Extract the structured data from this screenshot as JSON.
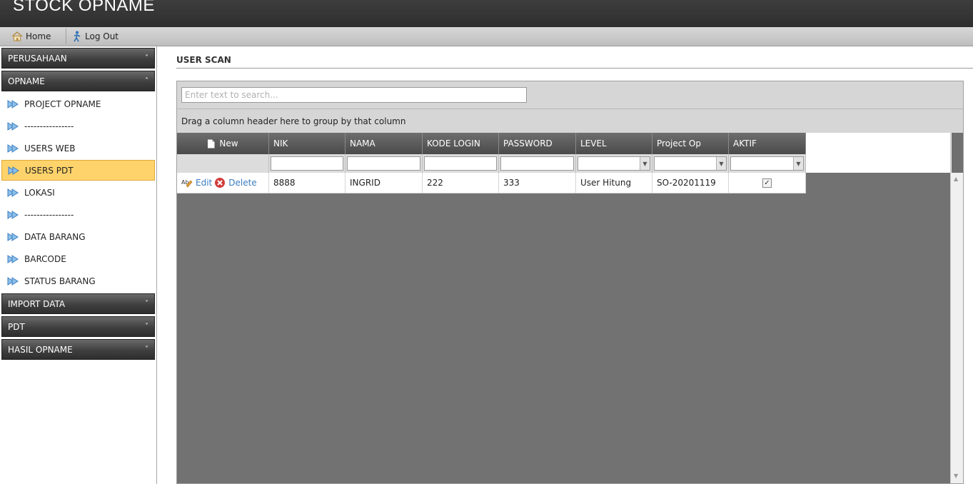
{
  "app": {
    "title": "STOCK OPNAME"
  },
  "nav": {
    "home_label": "Home",
    "logout_label": "Log Out"
  },
  "sidebar": {
    "groups": [
      {
        "label": "PERUSAHAAN",
        "chevron": "˅"
      },
      {
        "label": "OPNAME",
        "chevron": "˄"
      },
      {
        "label": "IMPORT DATA",
        "chevron": "˅"
      },
      {
        "label": "PDT",
        "chevron": "˅"
      },
      {
        "label": "HASIL OPNAME",
        "chevron": "˅"
      }
    ],
    "items": [
      {
        "label": "PROJECT OPNAME"
      },
      {
        "label": "----------------"
      },
      {
        "label": "USERS WEB"
      },
      {
        "label": "USERS PDT"
      },
      {
        "label": "LOKASI"
      },
      {
        "label": "----------------"
      },
      {
        "label": "DATA BARANG"
      },
      {
        "label": "BARCODE"
      },
      {
        "label": "STATUS BARANG"
      }
    ],
    "selected_item": "USERS PDT",
    "selected_color": "#ffd36b"
  },
  "main": {
    "page_title": "USER SCAN",
    "search": {
      "placeholder": "Enter text to search...",
      "value": ""
    },
    "group_panel_text": "Drag a column header here to group by that column",
    "columns": {
      "new_label": "New",
      "headers": [
        "NIK",
        "NAMA",
        "KODE LOGIN",
        "PASSWORD",
        "LEVEL",
        "Project Op",
        "AKTIF"
      ]
    },
    "row": {
      "edit_label": "Edit",
      "delete_label": "Delete",
      "cells": [
        "8888",
        "INGRID",
        "222",
        "333",
        "User Hitung",
        "SO-20201119"
      ],
      "aktif": true,
      "aktif_mark": "✓"
    }
  },
  "colors": {
    "link": "#3a7cc0",
    "header_dark": "#4a4a4a",
    "grid_bg": "#727272"
  }
}
